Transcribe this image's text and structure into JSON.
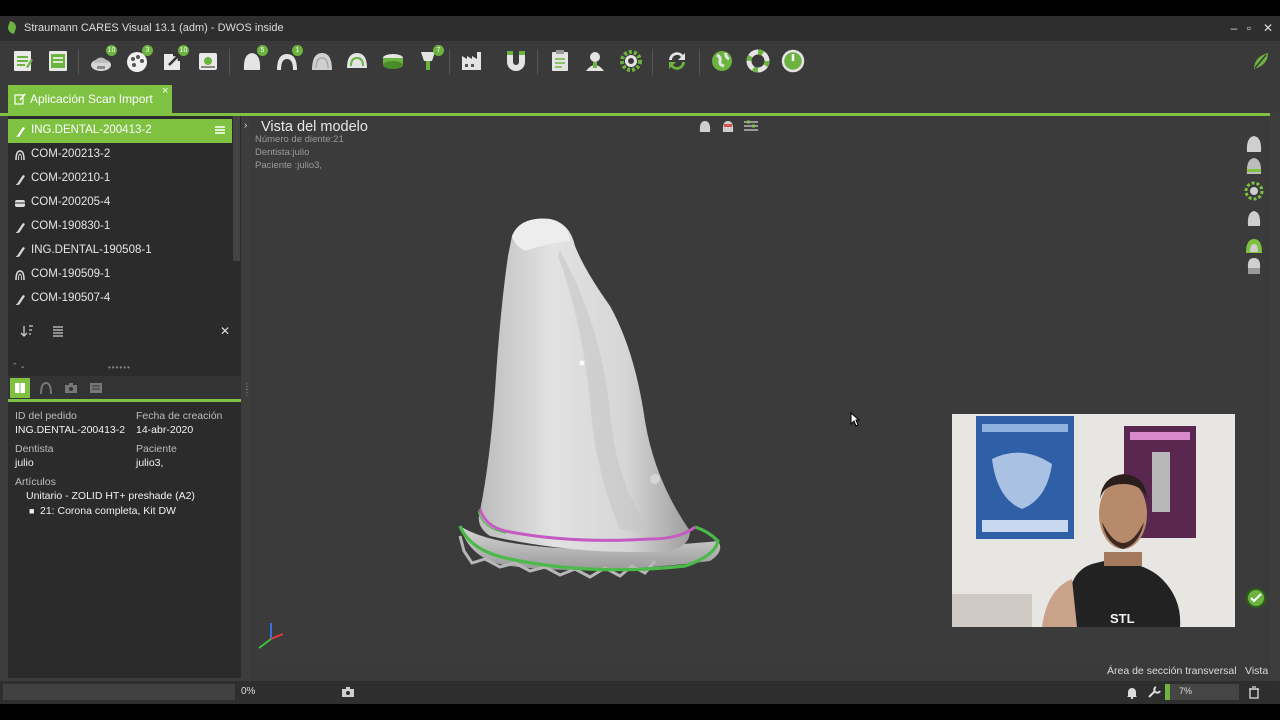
{
  "window": {
    "title": "Straumann CARES Visual 13.1  (adm) - DWOS inside"
  },
  "toolbar": {
    "buttons": [
      {
        "icon": "order-form-icon",
        "badge": ""
      },
      {
        "icon": "order-list-icon",
        "badge": ""
      },
      {
        "icon": "scan-upload-icon",
        "badge": "10"
      },
      {
        "icon": "palette-icon",
        "badge": "3"
      },
      {
        "icon": "export-icon",
        "badge": "10"
      },
      {
        "icon": "database-icon",
        "badge": ""
      },
      {
        "icon": "tooth-model-icon",
        "badge": "5"
      },
      {
        "icon": "implant-arch-icon",
        "badge": "1"
      },
      {
        "icon": "gingiva-icon",
        "badge": ""
      },
      {
        "icon": "full-arch-icon",
        "badge": ""
      },
      {
        "icon": "model-base-icon",
        "badge": ""
      },
      {
        "icon": "abutment-icon",
        "badge": "7"
      },
      {
        "icon": "factory-icon",
        "badge": ""
      },
      {
        "icon": "magnet-icon",
        "badge": ""
      },
      {
        "icon": "clipboard-icon",
        "badge": ""
      },
      {
        "icon": "user-admin-icon",
        "badge": ""
      },
      {
        "icon": "settings-gear-icon",
        "badge": ""
      },
      {
        "icon": "refresh-icon",
        "badge": ""
      },
      {
        "icon": "globe-icon",
        "badge": ""
      },
      {
        "icon": "lifebuoy-icon",
        "badge": ""
      },
      {
        "icon": "power-icon",
        "badge": ""
      }
    ]
  },
  "tab": {
    "label": "Aplicación Scan Import",
    "close": "×"
  },
  "orders": [
    {
      "label": "ING.DENTAL-200413-2",
      "icon": "crown-icon",
      "selected": true
    },
    {
      "label": "COM-200213-2",
      "icon": "arch-icon",
      "selected": false
    },
    {
      "label": "COM-200210-1",
      "icon": "crown-icon",
      "selected": false
    },
    {
      "label": "COM-200205-4",
      "icon": "bridge-icon",
      "selected": false
    },
    {
      "label": "COM-190830-1",
      "icon": "crown-icon",
      "selected": false
    },
    {
      "label": "ING.DENTAL-190508-1",
      "icon": "crown-icon",
      "selected": false
    },
    {
      "label": "COM-190509-1",
      "icon": "arch-icon",
      "selected": false
    },
    {
      "label": "COM-190507-4",
      "icon": "crown-icon",
      "selected": false
    }
  ],
  "filter": {
    "placeholder": "",
    "close": "✕"
  },
  "details": {
    "order_id_label": "ID del pedido",
    "order_id": "ING.DENTAL-200413-2",
    "created_label": "Fecha de creación",
    "created": "14-abr-2020",
    "dentist_label": "Dentista",
    "dentist": "julio",
    "patient_label": "Paciente",
    "patient": "julio3,",
    "articles_label": "Artículos",
    "article": "Unitario - ZOLID HT+ preshade (A2)",
    "article_item": "21: Corona completa, Kit DW"
  },
  "viewport": {
    "title": "Vista del modelo",
    "tooth_number": "Número de diente:21",
    "dentist": "Dentista:julio",
    "patient": "Paciente :julio3,",
    "background": "#3b3b3b"
  },
  "bottom": {
    "section_area": "Área de sección transversal",
    "view": "Vista"
  },
  "status": {
    "progress_text": "0%",
    "zoom_text": "7%",
    "zoom_fraction": 0.07
  },
  "webcam": {
    "shirt_text": "STL"
  },
  "colors": {
    "accent": "#7fc242",
    "brand_green": "#6cb33f",
    "margin_line_green": "#4cba4a",
    "margin_line_pink": "#c55bc2"
  }
}
